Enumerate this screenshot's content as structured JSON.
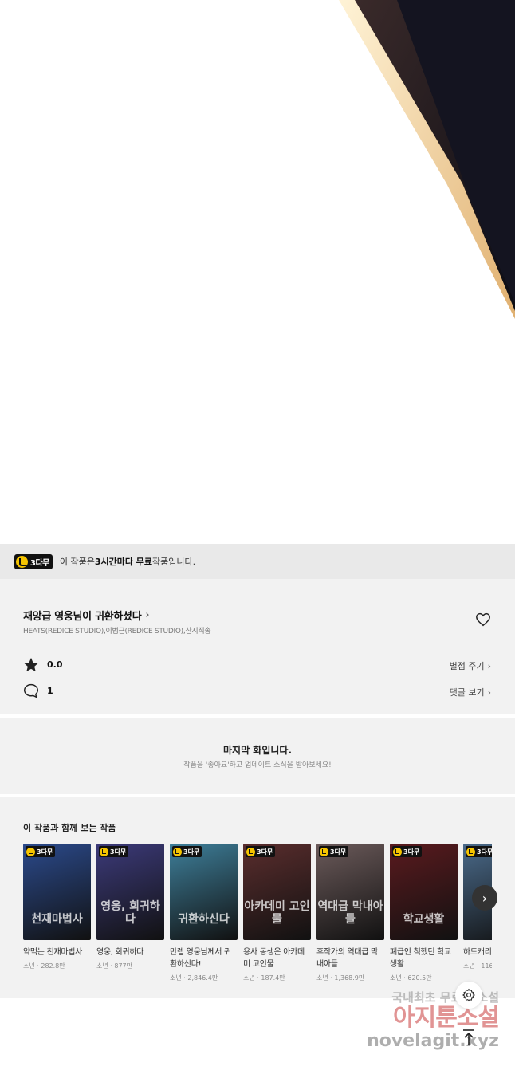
{
  "banner": {
    "badge": "3다무",
    "prefix": "이 작품은 ",
    "bold": "3시간마다 무료",
    "suffix": " 작품입니다."
  },
  "series": {
    "title": "재앙급 영웅님이 귀환하셨다",
    "authors": "HEATS(REDICE STUDIO),이범근(REDICE STUDIO),산지직송",
    "rating": "0.0",
    "comments": "1",
    "rate_label": "별점 주기",
    "comments_label": "댓글 보기"
  },
  "last_episode": {
    "heading": "마지막 화입니다.",
    "sub": "작품을 '좋아요'하고 업데이트 소식을 받아보세요!"
  },
  "recommendations": {
    "heading": "이 작품과 함께 보는 작품",
    "badge": "3다무",
    "items": [
      {
        "title": "약먹는 천재마법사",
        "meta": "소년 · 282.8만",
        "color": "#2b4a8c",
        "deco": "천재마법사"
      },
      {
        "title": "영웅, 회귀하다",
        "meta": "소년 · 877만",
        "color": "#3c3a7a",
        "deco": "영웅, 회귀하다"
      },
      {
        "title": "만렙 영웅님께서 귀환하신다!",
        "meta": "소년 · 2,846.4만",
        "color": "#3e7f9a",
        "deco": "귀환하신다"
      },
      {
        "title": "용사 동생은 아카데미 고인물",
        "meta": "소년 · 187.4만",
        "color": "#5a2d2d",
        "deco": "아카데미 고인물"
      },
      {
        "title": "후작가의 역대급 막내아들",
        "meta": "소년 · 1,368.9만",
        "color": "#6b5a5a",
        "deco": "역대급 막내아들"
      },
      {
        "title": "폐급인 척했던 학교생활",
        "meta": "소년 · 620.5만",
        "color": "#5a1a1e",
        "deco": "학교생활"
      },
      {
        "title": "하드캐리",
        "meta": "소년 · 116",
        "color": "#4a6a8a",
        "deco": ""
      }
    ]
  },
  "watermark": {
    "line1": "국내최초 무료 웹소설",
    "line2": "아지툰소설",
    "line3": "novelagit.xyz"
  }
}
